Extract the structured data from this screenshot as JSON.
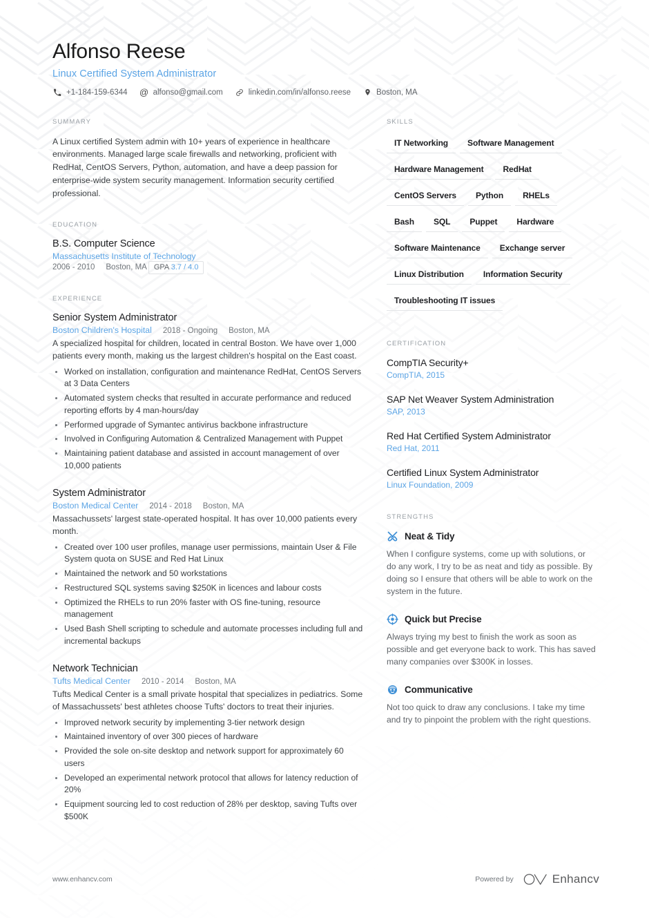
{
  "theme": {
    "accent": "#5ba4e5",
    "text": "#3c4043",
    "muted": "#70757a",
    "label": "#9aa0a6",
    "heading": "#202124",
    "watermark": "#f1f2f4"
  },
  "header": {
    "name": "Alfonso Reese",
    "job_title": "Linux Certified System Administrator",
    "contacts": [
      {
        "icon": "phone-icon",
        "text": "+1-184-159-6344"
      },
      {
        "icon": "email-icon",
        "text": "alfonso@gmail.com"
      },
      {
        "icon": "link-icon",
        "text": "linkedin.com/in/alfonso.reese"
      },
      {
        "icon": "location-icon",
        "text": "Boston, MA"
      }
    ]
  },
  "summary": {
    "label": "SUMMARY",
    "text": "A Linux certified System admin with 10+ years of experience in healthcare environments. Managed large scale firewalls and networking, proficient with RedHat, CentOS Servers, Python, automation, and have a deep passion for enterprise-wide system security management. Information security certified professional."
  },
  "education": {
    "label": "EDUCATION",
    "entries": [
      {
        "degree": "B.S. Computer Science",
        "school": "Massachusetts Institute of Technology",
        "dates": "2006 - 2010",
        "location": "Boston, MA",
        "gpa_label": "GPA",
        "gpa_value": "3.7 / 4.0"
      }
    ]
  },
  "experience": {
    "label": "EXPERIENCE",
    "entries": [
      {
        "title": "Senior System Administrator",
        "company": "Boston Children's Hospital",
        "dates": "2018 - Ongoing",
        "location": "Boston, MA",
        "description": "A specialized hospital for children, located in central Boston. We have over 1,000 patients every month, making us the largest children's hospital on the East coast.",
        "bullets": [
          "Worked on installation, configuration and maintenance RedHat, CentOS Servers at 3 Data Centers",
          "Automated system checks that resulted in accurate performance and reduced reporting efforts by 4 man-hours/day",
          "Performed upgrade of Symantec antivirus backbone infrastructure",
          "Involved in Configuring Automation & Centralized Management with Puppet",
          "Maintaining patient database and assisted in account management of over 10,000 patients"
        ]
      },
      {
        "title": "System Administrator",
        "company": "Boston Medical Center",
        "dates": "2014 - 2018",
        "location": "Boston, MA",
        "description": "Massachussets' largest state-operated hospital. It has over 10,000 patients every month.",
        "bullets": [
          "Created over 100 user profiles, manage user permissions, maintain User & File System quota on SUSE and Red Hat Linux",
          "Maintained the network and 50 workstations",
          "Restructured SQL systems saving $250K in licences and labour costs",
          "Optimized the RHELs to run 20% faster with OS fine-tuning, resource management",
          "Used Bash Shell scripting to schedule and automate processes including full and incremental backups"
        ]
      },
      {
        "title": "Network Technician",
        "company": "Tufts Medical Center",
        "dates": "2010 - 2014",
        "location": "Boston, MA",
        "description": "Tufts Medical Center is a small private hospital that specializes in pediatrics. Some of Massachussets' best athletes choose Tufts' doctors to treat their injuries.",
        "bullets": [
          "Improved network security by implementing 3-tier network design",
          "Maintained inventory of over 300 pieces of hardware",
          "Provided the sole on-site desktop and network support for approximately 60 users",
          "Developed an experimental network protocol that allows for latency reduction of 20%",
          "Equipment sourcing led to cost reduction of 28% per desktop, saving Tufts over $500K"
        ]
      }
    ]
  },
  "skills": {
    "label": "SKILLS",
    "items": [
      "IT Networking",
      "Software Management",
      "Hardware Management",
      "RedHat",
      "CentOS Servers",
      "Python",
      "RHELs",
      "Bash",
      "SQL",
      "Puppet",
      "Hardware",
      "Software Maintenance",
      "Exchange server",
      "Linux Distribution",
      "Information Security",
      "Troubleshooting IT issues"
    ]
  },
  "certification": {
    "label": "CERTIFICATION",
    "items": [
      {
        "name": "CompTIA Security+",
        "issuer": "CompTIA, 2015"
      },
      {
        "name": "SAP Net Weaver System Administration",
        "issuer": "SAP, 2013"
      },
      {
        "name": "Red Hat Certified System Administrator",
        "issuer": "Red Hat, 2011"
      },
      {
        "name": "Certified Linux System Administrator",
        "issuer": "Linux Foundation, 2009"
      }
    ]
  },
  "strengths": {
    "label": "STRENGTHS",
    "items": [
      {
        "icon": "tools-icon",
        "title": "Neat & Tidy",
        "text": "When I configure systems, come up with solutions, or do any work, I try to be as neat and tidy as possible. By doing so I ensure that others will be able to work on the system in the future."
      },
      {
        "icon": "target-icon",
        "title": "Quick but Precise",
        "text": "Always trying my best to finish the work as soon as possible and get everyone back to work. This has saved many companies over $300K in losses."
      },
      {
        "icon": "face-icon",
        "title": "Communicative",
        "text": "Not too quick to draw any conclusions. I take my time and try to pinpoint the problem with the right questions."
      }
    ]
  },
  "footer": {
    "url": "www.enhancv.com",
    "powered_by": "Powered by",
    "brand": "Enhancv"
  }
}
